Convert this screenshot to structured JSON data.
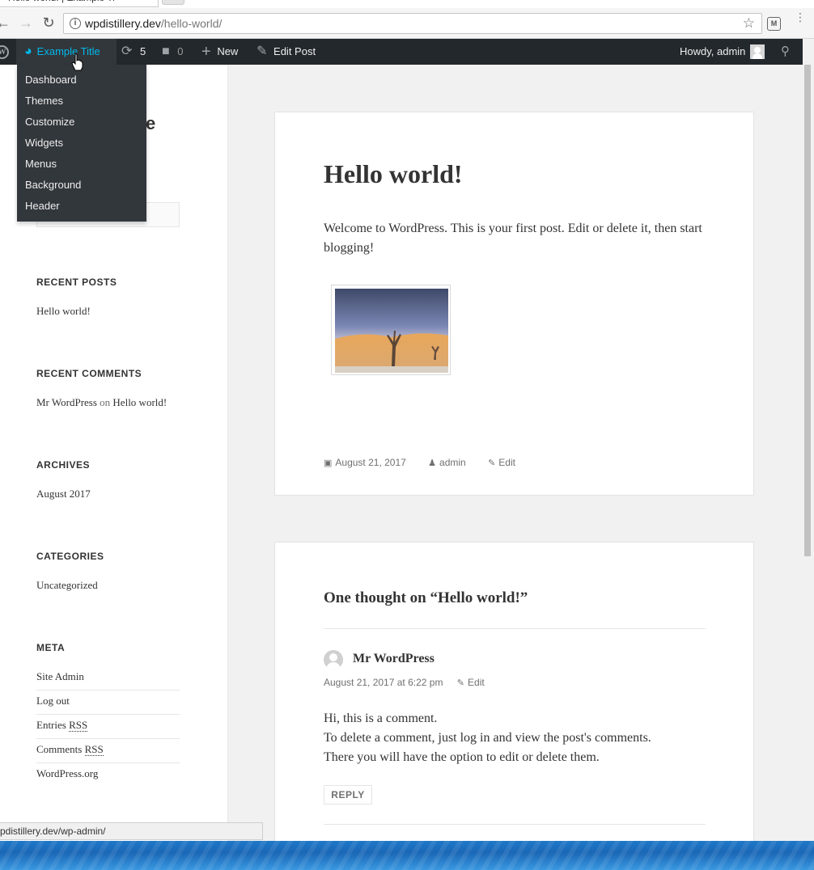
{
  "browser": {
    "tab_title": "Hello world! | Example Ti",
    "url_host": "wpdistillery.dev",
    "url_path": "/hello-world/",
    "ext_label": "M",
    "status_url": "pdistillery.dev/wp-admin/"
  },
  "adminbar": {
    "wp_logo_letter": "W",
    "site_name": "Example Title",
    "updates_count": "5",
    "comments_count": "0",
    "new_label": "New",
    "edit_post_label": "Edit Post",
    "howdy": "Howdy, admin",
    "site_menu": [
      "Dashboard",
      "Themes",
      "Customize",
      "Widgets",
      "Menus",
      "Background",
      "Header"
    ]
  },
  "sidebar": {
    "site_title_fragment": "e",
    "recent_posts": {
      "title": "RECENT POSTS",
      "items": [
        "Hello world!"
      ]
    },
    "recent_comments": {
      "title": "RECENT COMMENTS",
      "author": "Mr WordPress",
      "on": "on",
      "post": "Hello world!"
    },
    "archives": {
      "title": "ARCHIVES",
      "items": [
        "August 2017"
      ]
    },
    "categories": {
      "title": "CATEGORIES",
      "items": [
        "Uncategorized"
      ]
    },
    "meta": {
      "title": "META",
      "site_admin": "Site Admin",
      "log_out": "Log out",
      "entries_prefix": "Entries ",
      "comments_prefix": "Comments ",
      "rss": "RSS",
      "wordpress_org": "WordPress.org"
    }
  },
  "post": {
    "title": "Hello world!",
    "content": "Welcome to WordPress. This is your first post. Edit or delete it, then start blogging!",
    "date": "August 21, 2017",
    "author": "admin",
    "edit": "Edit"
  },
  "comments": {
    "title": "One thought on “Hello world!”",
    "author": "Mr WordPress",
    "date": "August 21, 2017 at 6:22 pm",
    "edit": "Edit",
    "line1": "Hi, this is a comment.",
    "line2": "To delete a comment, just log in and view the post's comments.",
    "line3": "There you will have the option to edit or delete them.",
    "reply": "REPLY"
  },
  "colors": {
    "adminbar_bg": "#23282d",
    "submenu_bg": "#32373c",
    "accent": "#00b9eb",
    "page_bg": "#f1f1f1"
  }
}
